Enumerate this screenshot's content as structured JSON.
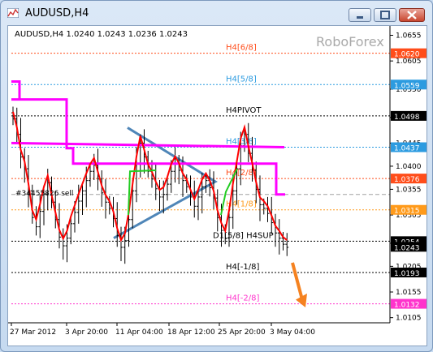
{
  "window": {
    "title": "AUDUSD,H4"
  },
  "header": {
    "symbol_line": "AUDUSD,H4 1.0240 1.0243 1.0236 1.0243",
    "watermark": "RoboForex"
  },
  "price_axis": {
    "ticks": [
      "1.0655",
      "1.0605",
      "1.0550",
      "1.0495",
      "1.0445",
      "1.0400",
      "1.0355",
      "1.0305",
      "1.0250",
      "1.0205",
      "1.0155",
      "1.0105"
    ],
    "ylim": [
      1.0095,
      1.067
    ]
  },
  "levels": [
    {
      "price": 1.062,
      "label": "H4[6/8]",
      "tag": "1.0620",
      "color": "#ff4d1a"
    },
    {
      "price": 1.0559,
      "label": "H4[5/8]",
      "tag": "1.0559",
      "color": "#2c9be0"
    },
    {
      "price": 1.0498,
      "label": "H4PIVOT",
      "tag": "1.0498",
      "color": "#000000"
    },
    {
      "price": 1.0437,
      "label": "H4[3/8]",
      "tag": "1.0437",
      "color": "#2c9be0"
    },
    {
      "price": 1.0376,
      "label": "H4[2/8]",
      "tag": "1.0376",
      "color": "#ff4d1a"
    },
    {
      "price": 1.0315,
      "label": "H4[1/8]",
      "tag": "1.0315",
      "color": "#ff9a1a"
    },
    {
      "price": 1.0254,
      "label": "D1[5/8] H4SUP",
      "tag": "1.0254",
      "color": "#000000"
    },
    {
      "price": 1.0193,
      "label": "H4[-1/8]",
      "tag": "1.0193",
      "color": "#000000"
    },
    {
      "price": 1.0132,
      "label": "H4[-2/8]",
      "tag": "1.0132",
      "color": "#ff33cc"
    }
  ],
  "current_price": {
    "price": 1.0243,
    "tag": "1.0243",
    "color": "#000000"
  },
  "annotation": {
    "text": "#34455826 sell"
  },
  "time_axis": {
    "labels": [
      "27 Mar 2012",
      "3 Apr 20:00",
      "11 Apr 04:00",
      "18 Apr 12:00",
      "25 Apr 20:00",
      "3 May 04:00"
    ]
  },
  "colors": {
    "magenta": "#ff00ff",
    "red": "#ff0000",
    "green": "#22cc22",
    "triangle": "#4f86b8",
    "arrow": "#f58220",
    "grey_level": "#a0a0a0"
  },
  "chart_data": {
    "type": "line",
    "series": [
      {
        "values": [
          1.0492,
          1.0462,
          1.0418,
          1.0395,
          1.0352,
          1.03,
          1.0282,
          1.0312,
          1.0346,
          1.0368,
          1.033,
          1.0296,
          1.0262,
          1.0245,
          1.026,
          1.0288,
          1.031,
          1.0332,
          1.0352,
          1.0372,
          1.039,
          1.0402,
          1.0375,
          1.0348,
          1.033,
          1.0318,
          1.0298,
          1.0265,
          1.0242,
          1.0255,
          1.0296,
          1.0352,
          1.0405,
          1.0445,
          1.0418,
          1.039,
          1.0375,
          1.0356,
          1.034,
          1.0345,
          1.0365,
          1.039,
          1.0405,
          1.0392,
          1.0372,
          1.036,
          1.034,
          1.0322,
          1.034,
          1.036,
          1.0372,
          1.0358,
          1.0338,
          1.03,
          1.0275,
          1.026,
          1.03,
          1.0352,
          1.0395,
          1.044,
          1.0462,
          1.0425,
          1.0392,
          1.0355,
          1.0325,
          1.0318,
          1.0308,
          1.029,
          1.027,
          1.026,
          1.0248,
          1.0242
        ]
      }
    ]
  }
}
